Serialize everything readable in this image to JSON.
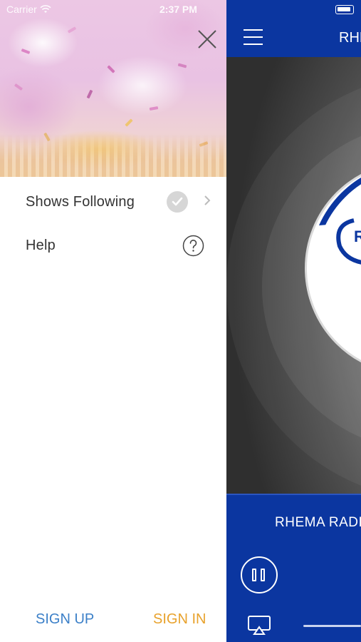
{
  "status_bar": {
    "carrier": "Carrier",
    "time": "2:37 PM"
  },
  "drawer": {
    "menu": [
      {
        "label": "Shows Following",
        "icon": "checkmark-icon",
        "trailing": "chevron-right-icon"
      },
      {
        "label": "Help",
        "icon": "question-circle-icon"
      }
    ],
    "sign_up_label": "SIGN UP",
    "sign_in_label": "SIGN IN"
  },
  "player": {
    "title": "RHE",
    "station_name": "RHEMA RADI",
    "state": "playing"
  },
  "colors": {
    "brand_blue": "#0b36a0",
    "sign_up": "#3c80c8",
    "sign_in": "#e8a22c"
  }
}
